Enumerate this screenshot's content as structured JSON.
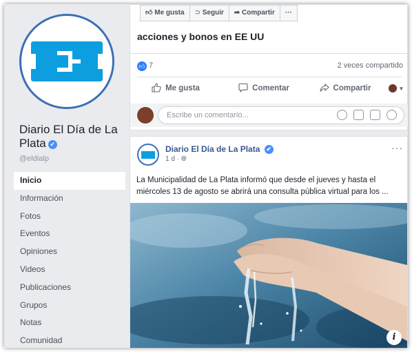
{
  "sidebar": {
    "page_name": "Diario El Día de La Plata",
    "username": "@eldialp",
    "nav": [
      {
        "label": "Inicio",
        "active": true
      },
      {
        "label": "Información"
      },
      {
        "label": "Fotos"
      },
      {
        "label": "Eventos"
      },
      {
        "label": "Opiniones"
      },
      {
        "label": "Videos"
      },
      {
        "label": "Publicaciones"
      },
      {
        "label": "Grupos"
      },
      {
        "label": "Notas"
      },
      {
        "label": "Comunidad"
      }
    ]
  },
  "page_actions": {
    "like": "Me gusta",
    "follow": "Seguir",
    "share": "Compartir",
    "more": "···"
  },
  "post1": {
    "headline": "acciones y bonos en EE UU",
    "like_count": "7",
    "shares": "2 veces compartido",
    "actions": {
      "like": "Me gusta",
      "comment": "Comentar",
      "share": "Compartir"
    },
    "comment_placeholder": "Escribe un comentario..."
  },
  "post2": {
    "author": "Diario El Día de La Plata",
    "meta": "1 d · ",
    "more": "···",
    "text": "La Municipalidad de La Plata informó que desde el jueves y hasta el miércoles 13 de agosto se abrirá una consulta pública virtual para los ...",
    "info": "i"
  },
  "icons": {
    "verified": "check-badge-icon",
    "globe": "globe-icon",
    "like": "thumbs-up-icon",
    "comment": "speech-bubble-icon",
    "share": "share-arrow-icon"
  },
  "colors": {
    "brand_blue": "#0d9ee0",
    "facebook_link": "#385898",
    "like_blue": "#2d7ff9",
    "background": "#e9ebee"
  }
}
